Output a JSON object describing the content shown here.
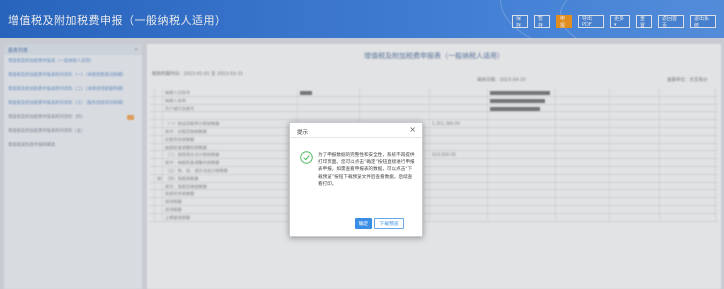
{
  "header": {
    "title": "增值税及附加税费申报（一般纳税人适用）",
    "toolbar": [
      {
        "label": "保存",
        "active": false
      },
      {
        "label": "暂存",
        "active": false
      },
      {
        "label": "申报",
        "active": true
      },
      {
        "label": "导出PDF",
        "active": false
      },
      {
        "label": "更多 ▾",
        "active": false
      },
      {
        "label": "重置",
        "active": false
      },
      {
        "label": "返回首页",
        "active": false
      },
      {
        "label": "退出系统",
        "active": false
      }
    ]
  },
  "sidebar": {
    "heading": "报表列表",
    "items": [
      "增值税及附加税费申报表（一般纳税人适用）",
      "增值税及附加税费申报表附列资料（一）（本期销售情况明细）",
      "增值税及附加税费申报表附列资料（二）（本期进项税额明细）",
      "增值税及附加税费申报表附列资料（三）（服务扣除项目明细）",
      "增值税及附加税费申报表附列资料（四）",
      "增值税及附加税费申报表附列资料（五）",
      "增值税减免税申报明细表"
    ]
  },
  "main": {
    "title": "增值税及附加税费申报表（一般纳税人适用）",
    "period_label": "税款所属时间：2023-01-01 至 2023-03-31",
    "fill_date": "填表日期：2023-04-10",
    "unit": "金额单位：元至角分",
    "row_labels": [
      "纳税人识别号",
      "纳税人名称",
      "开户银行及账号",
      "",
      "（一）按适用税率计税销售额",
      "其中：应税货物销售额",
      "应税劳务销售额",
      "纳税检查调整的销售额",
      "（二）按简易办法计税销售额",
      "其中：纳税检查调整的销售额",
      "（三）免、抵、退办法出口销售额",
      "（四）免税销售额",
      "其中：免税货物销售额",
      "免税劳务销售额",
      "销项税额",
      "进项税额",
      "上期留抵税额"
    ],
    "section_label": "销售额",
    "amount_1": "1,351,380.00",
    "amount_2": "624,000.00"
  },
  "dialog": {
    "title": "提示",
    "close": "×",
    "icon": "check-circle-icon",
    "message": "为了申报数据的完整性和安全性，系统不再提供打印页面。您可以点击“确定”按钮直接进行申报表申报，如需查看申报表的数据，可以点击“下载预览”按钮下载预览文件后查看数据，后续查看打印。",
    "ok_label": "确定",
    "download_label": "下载预览",
    "accent": "#3b8ee6"
  }
}
